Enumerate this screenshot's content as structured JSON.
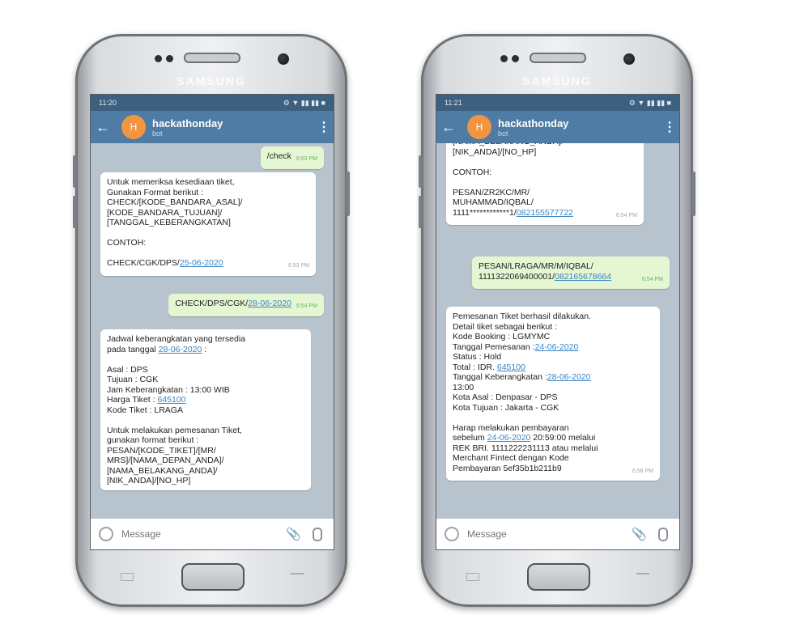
{
  "brand": "SAMSUNG",
  "phones": [
    {
      "status_time": "11:20",
      "status_icons": "⚙ ▼ ▮▮ ▮▮ ■",
      "chat_name": "hackathonday",
      "chat_subtitle": "bot",
      "avatar_letter": "H",
      "input_placeholder": "Message",
      "messages": [
        {
          "dir": "out",
          "time": "6:53 PM",
          "lines": [
            "/check"
          ]
        },
        {
          "dir": "in",
          "time": "6:53 PM",
          "lines": [
            "Untuk memeriksa kesediaan tiket,",
            "Gunakan Format berikut :",
            "CHECK/[KODE_BANDARA_ASAL]/",
            "[KODE_BANDARA_TUJUAN]/",
            "[TANGGAL_KEBERANGKATAN]",
            "",
            " CONTOH:",
            "",
            "CHECK/CGK/DPS/25-06-2020"
          ]
        },
        {
          "dir": "out",
          "time": "6:54 PM",
          "lines": [
            "CHECK/DPS/CGK/28-06-2020"
          ]
        },
        {
          "dir": "in",
          "time": "",
          "lines": [
            "Jadwal keberangkatan yang tersedia",
            "pada tanggal 28-06-2020 :",
            "",
            "Asal : DPS",
            "Tujuan : CGK",
            "Jam Keberangkatan : 13:00 WIB",
            "Harga Tiket : 645100",
            "Kode Tiket : LRAGA",
            "",
            "Untuk melakukan pemesanan Tiket,",
            "gunakan format berikut :",
            "PESAN/[KODE_TIKET]/[MR/",
            "MRS]/[NAMA_DEPAN_ANDA]/",
            "[NAMA_BELAKANG_ANDA]/",
            "[NIK_ANDA]/[NO_HP]"
          ]
        }
      ]
    },
    {
      "status_time": "11:21",
      "status_icons": "⚙ ▼ ▮▮ ▮▮ ■",
      "chat_name": "hackathonday",
      "chat_subtitle": "bot",
      "avatar_letter": "H",
      "input_placeholder": "Message",
      "messages": [
        {
          "dir": "in",
          "time": "6:54 PM",
          "lines": [
            "[NAMA_BELAKANG_ANDA]/",
            "[NIK_ANDA]/[NO_HP]",
            "",
            "CONTOH:",
            "",
            "PESAN/ZR2KC/MR/",
            "MUHAMMAD/IQBAL/",
            "1111************1/082155577722"
          ]
        },
        {
          "dir": "out",
          "time": "6:54 PM",
          "lines": [
            "PESAN/LRAGA/MR/M/IQBAL/",
            "1111322069400001/082165678664"
          ]
        },
        {
          "dir": "in",
          "time": "6:56 PM",
          "lines": [
            "Pemesanan Tiket berhasil dilakukan.",
            "Detail tiket sebagai berikut :",
            "Kode Booking : LGMYMC",
            "Tanggal Pemesanan :24-06-2020",
            "Status : Hold",
            "Total : IDR. 645100",
            "Tanggal Keberangkatan :28-06-2020",
            "13:00",
            "Kota Asal : Denpasar - DPS",
            "Kota Tujuan : Jakarta - CGK",
            "",
            "Harap melakukan pembayaran",
            "sebelum 24-06-2020 20:59:00 melalui",
            "REK BRI. 1111222231113 atau melalui",
            "Merchant Fintect dengan Kode",
            "Pembayaran 5ef35b1b211b9"
          ]
        }
      ]
    }
  ]
}
